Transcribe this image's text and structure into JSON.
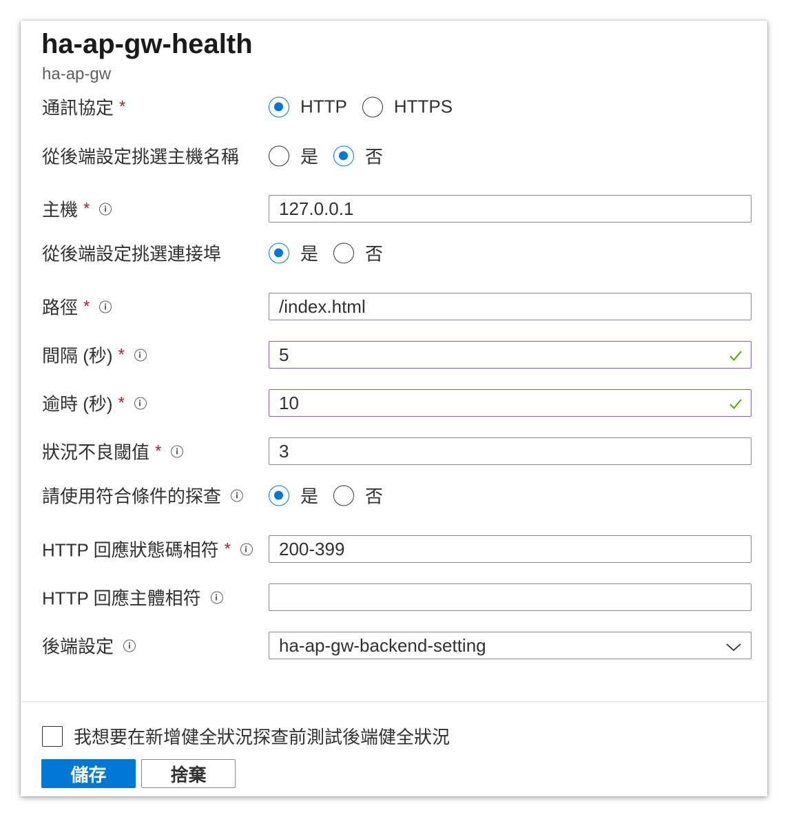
{
  "header": {
    "title": "ha-ap-gw-health",
    "subtitle": "ha-ap-gw"
  },
  "colors": {
    "accent": "#0078d4",
    "required": "#a4262c",
    "valid_border": "#8764b8",
    "valid_check": "#57a300"
  },
  "form": {
    "protocol": {
      "label": "通訊協定",
      "required": "*",
      "options": [
        {
          "label": "HTTP",
          "selected": true
        },
        {
          "label": "HTTPS",
          "selected": false
        }
      ]
    },
    "pick_host": {
      "label": "從後端設定挑選主機名稱",
      "options": [
        {
          "label": "是",
          "selected": false
        },
        {
          "label": "否",
          "selected": true
        }
      ]
    },
    "host": {
      "label": "主機",
      "required": "*",
      "value": "127.0.0.1"
    },
    "pick_port": {
      "label": "從後端設定挑選連接埠",
      "options": [
        {
          "label": "是",
          "selected": true
        },
        {
          "label": "否",
          "selected": false
        }
      ]
    },
    "path": {
      "label": "路徑",
      "required": "*",
      "value": "/index.html"
    },
    "interval": {
      "label": "間隔 (秒)",
      "required": "*",
      "value": "5"
    },
    "timeout": {
      "label": "逾時 (秒)",
      "required": "*",
      "value": "10"
    },
    "unhealthy": {
      "label": "狀況不良閾值",
      "required": "*",
      "value": "3"
    },
    "match": {
      "label": "請使用符合條件的探查",
      "options": [
        {
          "label": "是",
          "selected": true
        },
        {
          "label": "否",
          "selected": false
        }
      ]
    },
    "status_code": {
      "label": "HTTP 回應狀態碼相符",
      "required": "*",
      "value": "200-399"
    },
    "body_match": {
      "label": "HTTP 回應主體相符",
      "value": ""
    },
    "backend_setting": {
      "label": "後端設定",
      "value": "ha-ap-gw-backend-setting"
    }
  },
  "footer": {
    "test_checkbox_label": "我想要在新增健全狀況探查前測試後端健全狀況",
    "save_label": "儲存",
    "discard_label": "捨棄"
  }
}
